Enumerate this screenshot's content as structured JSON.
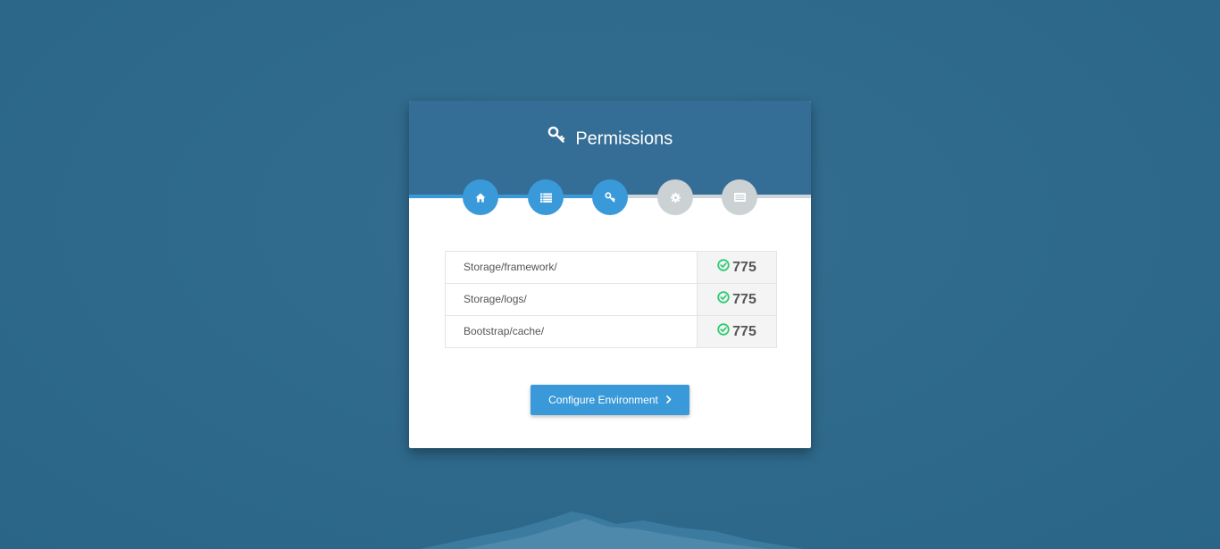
{
  "header": {
    "title": "Permissions",
    "title_icon": "key-icon"
  },
  "steps": [
    {
      "icon": "home-icon",
      "state": "complete"
    },
    {
      "icon": "list-icon",
      "state": "complete"
    },
    {
      "icon": "key-icon",
      "state": "active"
    },
    {
      "icon": "gear-icon",
      "state": "pending"
    },
    {
      "icon": "server-icon",
      "state": "pending"
    }
  ],
  "permissions": [
    {
      "path": "Storage/framework/",
      "value": "775",
      "status_icon": "check-circle-icon"
    },
    {
      "path": "Storage/logs/",
      "value": "775",
      "status_icon": "check-circle-icon"
    },
    {
      "path": "Bootstrap/cache/",
      "value": "775",
      "status_icon": "check-circle-icon"
    }
  ],
  "actions": {
    "next_label": "Configure Environment",
    "next_icon": "chevron-right-icon"
  },
  "colors": {
    "background": "#2f6a8c",
    "header": "#346e96",
    "accent": "#3a9ad9",
    "inactive_step": "#ccd1d4",
    "success": "#2ecc71"
  }
}
